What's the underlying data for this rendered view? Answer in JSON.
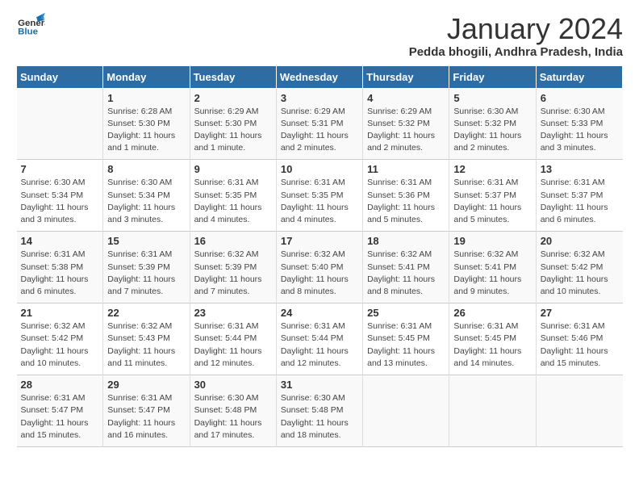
{
  "logo": {
    "line1": "General",
    "line2": "Blue"
  },
  "title": "January 2024",
  "location": "Pedda bhogili, Andhra Pradesh, India",
  "weekdays": [
    "Sunday",
    "Monday",
    "Tuesday",
    "Wednesday",
    "Thursday",
    "Friday",
    "Saturday"
  ],
  "weeks": [
    [
      {
        "day": "",
        "text": ""
      },
      {
        "day": "1",
        "text": "Sunrise: 6:28 AM\nSunset: 5:30 PM\nDaylight: 11 hours\nand 1 minute."
      },
      {
        "day": "2",
        "text": "Sunrise: 6:29 AM\nSunset: 5:30 PM\nDaylight: 11 hours\nand 1 minute."
      },
      {
        "day": "3",
        "text": "Sunrise: 6:29 AM\nSunset: 5:31 PM\nDaylight: 11 hours\nand 2 minutes."
      },
      {
        "day": "4",
        "text": "Sunrise: 6:29 AM\nSunset: 5:32 PM\nDaylight: 11 hours\nand 2 minutes."
      },
      {
        "day": "5",
        "text": "Sunrise: 6:30 AM\nSunset: 5:32 PM\nDaylight: 11 hours\nand 2 minutes."
      },
      {
        "day": "6",
        "text": "Sunrise: 6:30 AM\nSunset: 5:33 PM\nDaylight: 11 hours\nand 3 minutes."
      }
    ],
    [
      {
        "day": "7",
        "text": "Sunrise: 6:30 AM\nSunset: 5:34 PM\nDaylight: 11 hours\nand 3 minutes."
      },
      {
        "day": "8",
        "text": "Sunrise: 6:30 AM\nSunset: 5:34 PM\nDaylight: 11 hours\nand 3 minutes."
      },
      {
        "day": "9",
        "text": "Sunrise: 6:31 AM\nSunset: 5:35 PM\nDaylight: 11 hours\nand 4 minutes."
      },
      {
        "day": "10",
        "text": "Sunrise: 6:31 AM\nSunset: 5:35 PM\nDaylight: 11 hours\nand 4 minutes."
      },
      {
        "day": "11",
        "text": "Sunrise: 6:31 AM\nSunset: 5:36 PM\nDaylight: 11 hours\nand 5 minutes."
      },
      {
        "day": "12",
        "text": "Sunrise: 6:31 AM\nSunset: 5:37 PM\nDaylight: 11 hours\nand 5 minutes."
      },
      {
        "day": "13",
        "text": "Sunrise: 6:31 AM\nSunset: 5:37 PM\nDaylight: 11 hours\nand 6 minutes."
      }
    ],
    [
      {
        "day": "14",
        "text": "Sunrise: 6:31 AM\nSunset: 5:38 PM\nDaylight: 11 hours\nand 6 minutes."
      },
      {
        "day": "15",
        "text": "Sunrise: 6:31 AM\nSunset: 5:39 PM\nDaylight: 11 hours\nand 7 minutes."
      },
      {
        "day": "16",
        "text": "Sunrise: 6:32 AM\nSunset: 5:39 PM\nDaylight: 11 hours\nand 7 minutes."
      },
      {
        "day": "17",
        "text": "Sunrise: 6:32 AM\nSunset: 5:40 PM\nDaylight: 11 hours\nand 8 minutes."
      },
      {
        "day": "18",
        "text": "Sunrise: 6:32 AM\nSunset: 5:41 PM\nDaylight: 11 hours\nand 8 minutes."
      },
      {
        "day": "19",
        "text": "Sunrise: 6:32 AM\nSunset: 5:41 PM\nDaylight: 11 hours\nand 9 minutes."
      },
      {
        "day": "20",
        "text": "Sunrise: 6:32 AM\nSunset: 5:42 PM\nDaylight: 11 hours\nand 10 minutes."
      }
    ],
    [
      {
        "day": "21",
        "text": "Sunrise: 6:32 AM\nSunset: 5:42 PM\nDaylight: 11 hours\nand 10 minutes."
      },
      {
        "day": "22",
        "text": "Sunrise: 6:32 AM\nSunset: 5:43 PM\nDaylight: 11 hours\nand 11 minutes."
      },
      {
        "day": "23",
        "text": "Sunrise: 6:31 AM\nSunset: 5:44 PM\nDaylight: 11 hours\nand 12 minutes."
      },
      {
        "day": "24",
        "text": "Sunrise: 6:31 AM\nSunset: 5:44 PM\nDaylight: 11 hours\nand 12 minutes."
      },
      {
        "day": "25",
        "text": "Sunrise: 6:31 AM\nSunset: 5:45 PM\nDaylight: 11 hours\nand 13 minutes."
      },
      {
        "day": "26",
        "text": "Sunrise: 6:31 AM\nSunset: 5:45 PM\nDaylight: 11 hours\nand 14 minutes."
      },
      {
        "day": "27",
        "text": "Sunrise: 6:31 AM\nSunset: 5:46 PM\nDaylight: 11 hours\nand 15 minutes."
      }
    ],
    [
      {
        "day": "28",
        "text": "Sunrise: 6:31 AM\nSunset: 5:47 PM\nDaylight: 11 hours\nand 15 minutes."
      },
      {
        "day": "29",
        "text": "Sunrise: 6:31 AM\nSunset: 5:47 PM\nDaylight: 11 hours\nand 16 minutes."
      },
      {
        "day": "30",
        "text": "Sunrise: 6:30 AM\nSunset: 5:48 PM\nDaylight: 11 hours\nand 17 minutes."
      },
      {
        "day": "31",
        "text": "Sunrise: 6:30 AM\nSunset: 5:48 PM\nDaylight: 11 hours\nand 18 minutes."
      },
      {
        "day": "",
        "text": ""
      },
      {
        "day": "",
        "text": ""
      },
      {
        "day": "",
        "text": ""
      }
    ]
  ]
}
